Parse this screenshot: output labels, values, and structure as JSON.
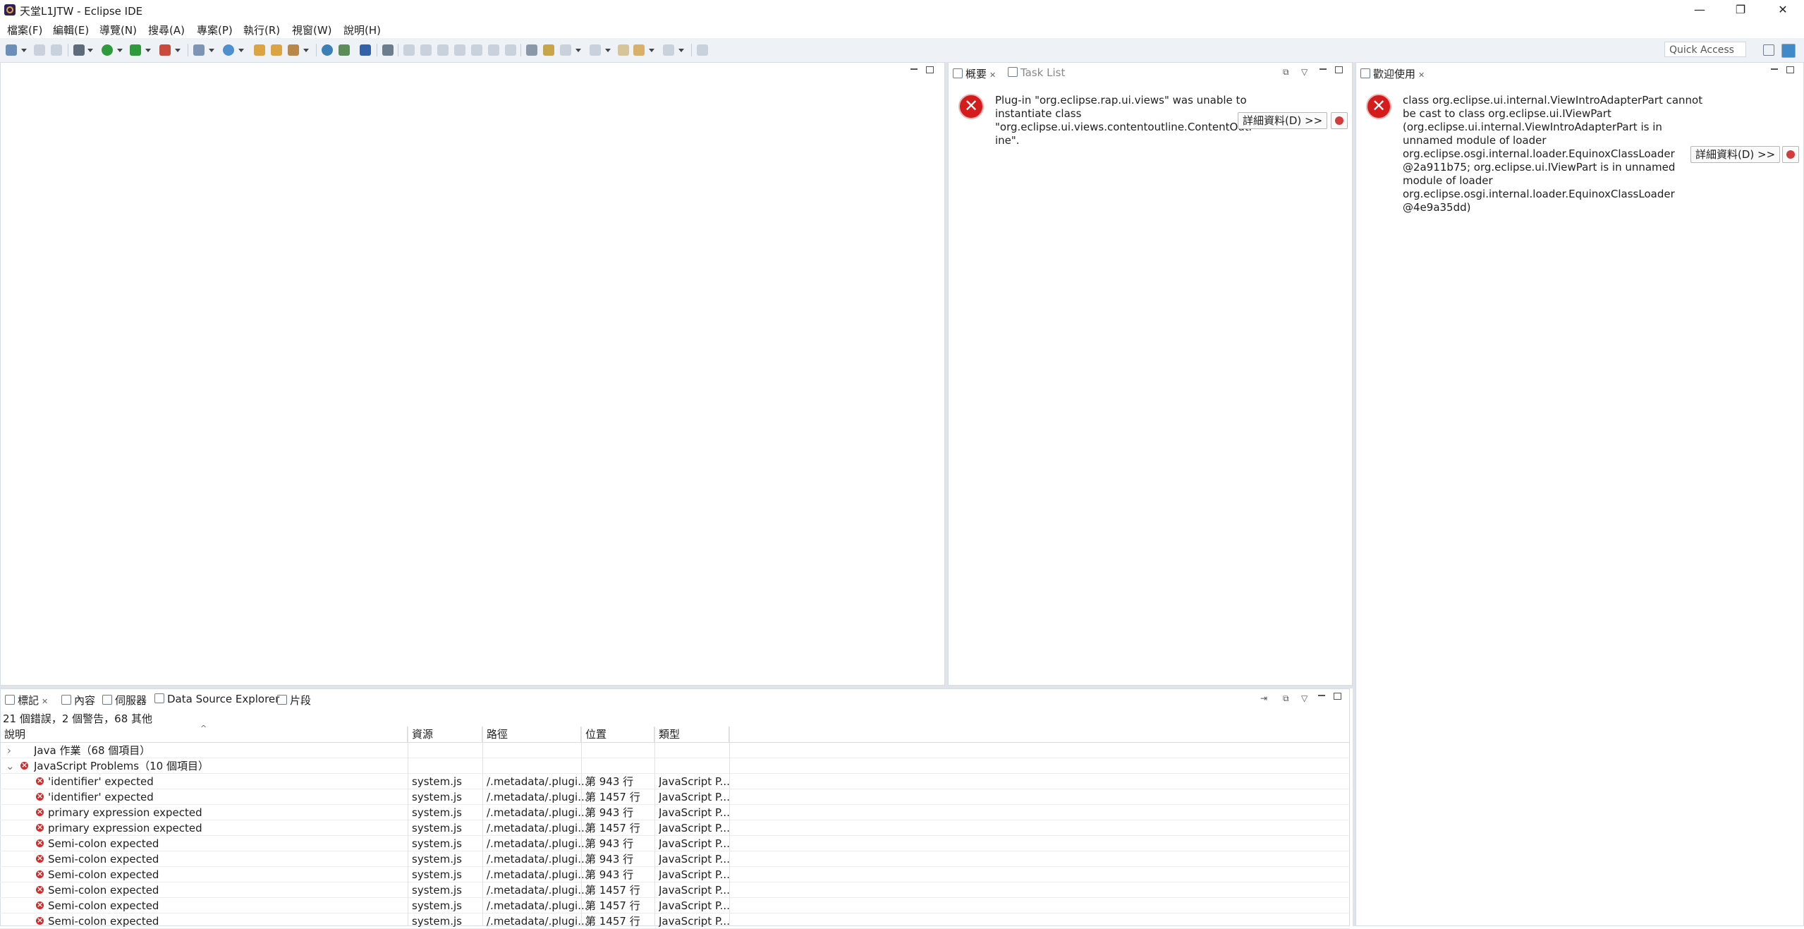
{
  "window": {
    "title": "天堂L1JTW - Eclipse IDE",
    "minimize": "—",
    "restore": "❐",
    "close": "✕"
  },
  "menubar": [
    "檔案(F)",
    "編輯(E)",
    "導覽(N)",
    "搜尋(A)",
    "專案(P)",
    "執行(R)",
    "視窗(W)",
    "說明(H)"
  ],
  "toolbar": {
    "quick_access": "Quick Access"
  },
  "outline_panel": {
    "tabs": [
      "概要",
      "Task List"
    ],
    "error_message": "Plug-in \"org.eclipse.rap.ui.views\" was unable to\ninstantiate class\n\"org.eclipse.ui.views.contentoutline.ContentOutl\nine\".",
    "details_button": "詳細資料(D) >>"
  },
  "welcome_panel": {
    "tab": "歡迎使用",
    "error_message": "class org.eclipse.ui.internal.ViewIntroAdapterPart cannot\nbe cast to class org.eclipse.ui.IViewPart\n(org.eclipse.ui.internal.ViewIntroAdapterPart is in\nunnamed module of loader\norg.eclipse.osgi.internal.loader.EquinoxClassLoader\n@2a911b75; org.eclipse.ui.IViewPart is in unnamed\nmodule of loader\norg.eclipse.osgi.internal.loader.EquinoxClassLoader\n@4e9a35dd)",
    "details_button": "詳細資料(D) >>"
  },
  "bottom_panel": {
    "tabs": [
      "標記",
      "內容",
      "伺服器",
      "Data Source Explorer",
      "片段"
    ],
    "summary": "21 個錯誤，2 個警告，68 其他",
    "columns": [
      "說明",
      "資源",
      "路徑",
      "位置",
      "類型"
    ],
    "groups": [
      {
        "label": "Java 作業（68 個項目）",
        "expanded": false
      },
      {
        "label": "JavaScript Problems（10 個項目）",
        "expanded": true
      }
    ],
    "rows": [
      {
        "desc": "'identifier' expected",
        "resource": "system.js",
        "path": "/.metadata/.plugi...",
        "location": "第 943 行",
        "type": "JavaScript P..."
      },
      {
        "desc": "'identifier' expected",
        "resource": "system.js",
        "path": "/.metadata/.plugi...",
        "location": "第 1457 行",
        "type": "JavaScript P..."
      },
      {
        "desc": "primary expression expected",
        "resource": "system.js",
        "path": "/.metadata/.plugi...",
        "location": "第 943 行",
        "type": "JavaScript P..."
      },
      {
        "desc": "primary expression expected",
        "resource": "system.js",
        "path": "/.metadata/.plugi...",
        "location": "第 1457 行",
        "type": "JavaScript P..."
      },
      {
        "desc": "Semi-colon expected",
        "resource": "system.js",
        "path": "/.metadata/.plugi...",
        "location": "第 943 行",
        "type": "JavaScript P..."
      },
      {
        "desc": "Semi-colon expected",
        "resource": "system.js",
        "path": "/.metadata/.plugi...",
        "location": "第 943 行",
        "type": "JavaScript P..."
      },
      {
        "desc": "Semi-colon expected",
        "resource": "system.js",
        "path": "/.metadata/.plugi...",
        "location": "第 943 行",
        "type": "JavaScript P..."
      },
      {
        "desc": "Semi-colon expected",
        "resource": "system.js",
        "path": "/.metadata/.plugi...",
        "location": "第 1457 行",
        "type": "JavaScript P..."
      },
      {
        "desc": "Semi-colon expected",
        "resource": "system.js",
        "path": "/.metadata/.plugi...",
        "location": "第 1457 行",
        "type": "JavaScript P..."
      },
      {
        "desc": "Semi-colon expected",
        "resource": "system.js",
        "path": "/.metadata/.plugi...",
        "location": "第 1457 行",
        "type": "JavaScript P..."
      }
    ]
  },
  "colors": {
    "error": "#d42b2b",
    "toolbar_bg": "#eef2f7",
    "sash": "#dfe4ea"
  }
}
